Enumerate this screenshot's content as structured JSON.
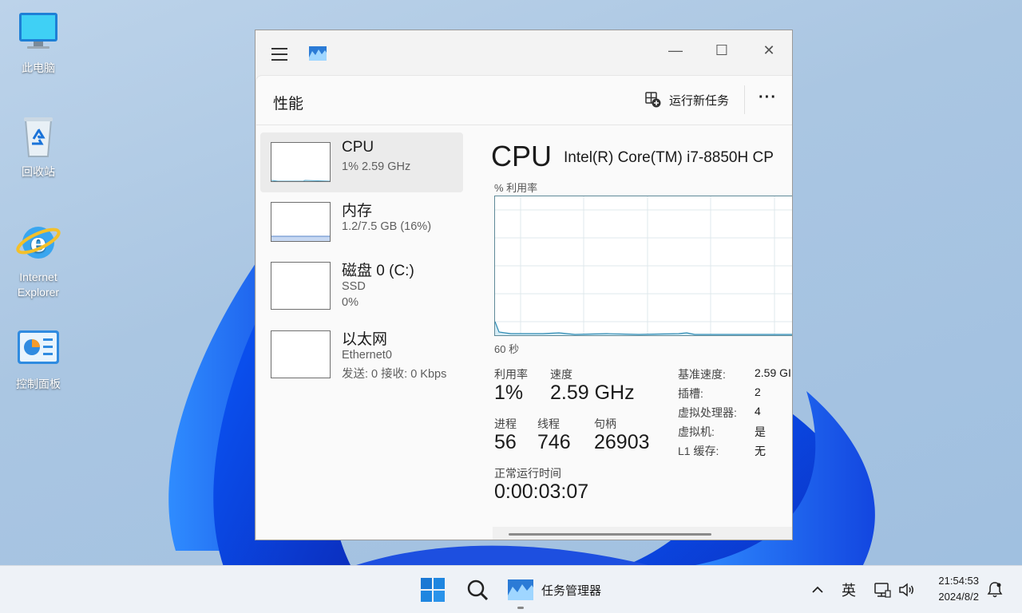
{
  "desktop": {
    "icons": [
      {
        "label": "此电脑"
      },
      {
        "label": "回收站"
      },
      {
        "label": "Internet Explorer"
      },
      {
        "label": "控制面板"
      }
    ]
  },
  "window": {
    "controls": {
      "minimize": "—",
      "maximize": "☐",
      "close": "✕"
    },
    "page_title": "性能",
    "run_task_label": "运行新任务",
    "more_label": "···"
  },
  "sidebar": {
    "items": [
      {
        "name": "CPU",
        "line1": "1% 2.59 GHz",
        "line2": ""
      },
      {
        "name": "内存",
        "line1": "1.2/7.5 GB (16%)",
        "line2": ""
      },
      {
        "name": "磁盘 0 (C:)",
        "line1": "SSD",
        "line2": "0%"
      },
      {
        "name": "以太网",
        "line1": "Ethernet0",
        "line2": "发送: 0 接收: 0 Kbps"
      }
    ]
  },
  "detail": {
    "title": "CPU",
    "model": "Intel(R) Core(TM) i7-8850H CP",
    "graph_label": "% 利用率",
    "graph_time": "60 秒",
    "stats": {
      "util_label": "利用率",
      "util_value": "1%",
      "speed_label": "速度",
      "speed_value": "2.59 GHz",
      "proc_label": "进程",
      "proc_value": "56",
      "thread_label": "线程",
      "thread_value": "746",
      "handle_label": "句柄",
      "handle_value": "26903",
      "uptime_label": "正常运行时间",
      "uptime_value": "0:00:03:07"
    },
    "specs": [
      {
        "k": "基准速度:",
        "v": "2.59 GI"
      },
      {
        "k": "插槽:",
        "v": "2"
      },
      {
        "k": "虚拟处理器:",
        "v": "4"
      },
      {
        "k": "虚拟机:",
        "v": "是"
      },
      {
        "k": "L1 缓存:",
        "v": "无"
      }
    ]
  },
  "taskbar": {
    "app_label": "任务管理器",
    "ime": "英",
    "time": "21:54:53",
    "date": "2024/8/2"
  }
}
